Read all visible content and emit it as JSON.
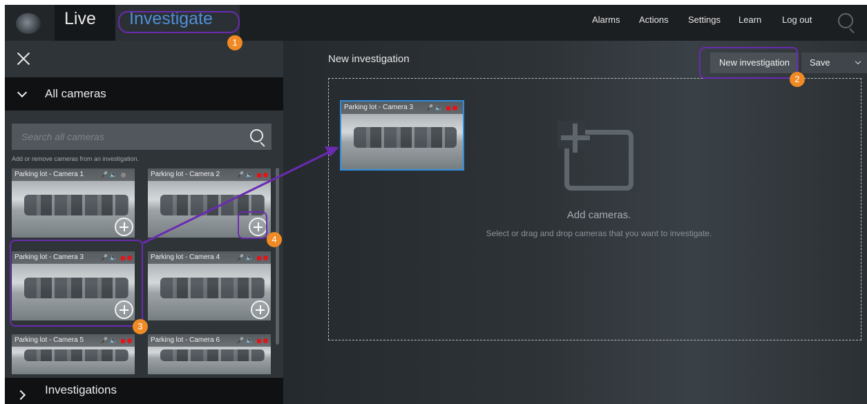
{
  "topbar": {
    "tabs": {
      "live": "Live",
      "investigate": "Investigate"
    },
    "nav": [
      "Alarms",
      "Actions",
      "Settings",
      "Learn",
      "Log out"
    ],
    "search_icon": "search-icon"
  },
  "sidebar": {
    "close_icon": "close-icon",
    "cameras_header": "All cameras",
    "search_placeholder": "Search all cameras",
    "hint": "Add or remove cameras from an investigation.",
    "cameras": [
      {
        "name": "Parking lot - Camera 1"
      },
      {
        "name": "Parking lot - Camera 2"
      },
      {
        "name": "Parking lot - Camera 3"
      },
      {
        "name": "Parking lot - Camera 4"
      },
      {
        "name": "Parking lot - Camera 5"
      },
      {
        "name": "Parking lot - Camera 6"
      }
    ],
    "investigations_header": "Investigations"
  },
  "main": {
    "title": "New investigation",
    "new_button": "New investigation",
    "save_button": "Save",
    "added_camera": "Parking lot - Camera 3",
    "empty_title": "Add cameras.",
    "empty_subtitle": "Select or drag and drop cameras that you want to investigate."
  },
  "annotations": [
    "1",
    "2",
    "3",
    "4"
  ],
  "colors": {
    "accent": "#4f8fd6",
    "annotation_ring": "#6a2bb0",
    "badge": "#f08a24",
    "record": "#e4141b"
  }
}
